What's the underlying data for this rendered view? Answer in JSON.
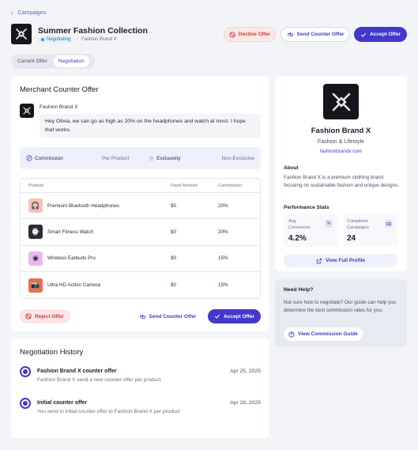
{
  "breadcrumb": {
    "label": "Campaigns"
  },
  "header": {
    "title": "Summer Fashion Collection",
    "status": "Negotiating",
    "brand": "Fashion Brand X",
    "decline_label": "Decline Offer",
    "counter_label": "Send Counter Offer",
    "accept_label": "Accept Offer"
  },
  "tabs": [
    {
      "label": "Current Offer"
    },
    {
      "label": "Negotiation"
    }
  ],
  "offer": {
    "heading": "Merchant Counter Offer",
    "sender": "Fashion Brand X",
    "message": "Hey Olivia, we can go as high as 20% on the headphones and watch at most. I hope that works.",
    "commission_label": "Commission",
    "commission_value": "Per Product",
    "exclusivity_label": "Exclusivity",
    "exclusivity_value": "Non-Exclusive",
    "columns": [
      "Product",
      "Fixed Amount",
      "Commission"
    ],
    "products": [
      {
        "name": "Premium Bluetooth Headphones",
        "fixed": "$0",
        "commission": "20%"
      },
      {
        "name": "Smart Fitness Watch",
        "fixed": "$0",
        "commission": "20%"
      },
      {
        "name": "Wireless Earbuds Pro",
        "fixed": "$0",
        "commission": "15%"
      },
      {
        "name": "Ultra HD Action Camera",
        "fixed": "$0",
        "commission": "15%"
      }
    ],
    "reject_label": "Reject Offer",
    "counter_label": "Send Counter Offer",
    "accept_label": "Accept Offer"
  },
  "history": {
    "heading": "Negotiation  History",
    "items": [
      {
        "title": "Fashion Brand X counter offer",
        "desc": "Fashion Brand X send a new counter offer per product",
        "date": "Apr 25, 2025"
      },
      {
        "title": "Initial counter offer",
        "desc": "You send in initial counter offer to Fashion Brand X per product",
        "date": "Apr 28, 2025"
      }
    ]
  },
  "brand_card": {
    "name": "Fashion Brand X",
    "category": "Fashion & Lifestyle",
    "website": "fashionbrandx.com",
    "about_heading": "About",
    "about_text": "Fashion Brand X is a premium clothing brand focusing on sustainable fashion and unique designs.",
    "stats_heading": "Performance Stats",
    "stat1_label_a": "Avg.",
    "stat1_label_b": "Conversion",
    "stat1_value": "4.2%",
    "stat2_label_a": "Completed",
    "stat2_label_b": "Campaigns",
    "stat2_value": "24",
    "profile_label": "View Full Profile"
  },
  "help": {
    "heading": "Need Help?",
    "text": "Not sure how to negotiate? Our guide can help you determine the best commission rates for you.",
    "button": "View Commission Guide"
  },
  "colors": {
    "accent": "#4338ca",
    "danger": "#d33a3a",
    "brand_bg": "#14161c"
  }
}
